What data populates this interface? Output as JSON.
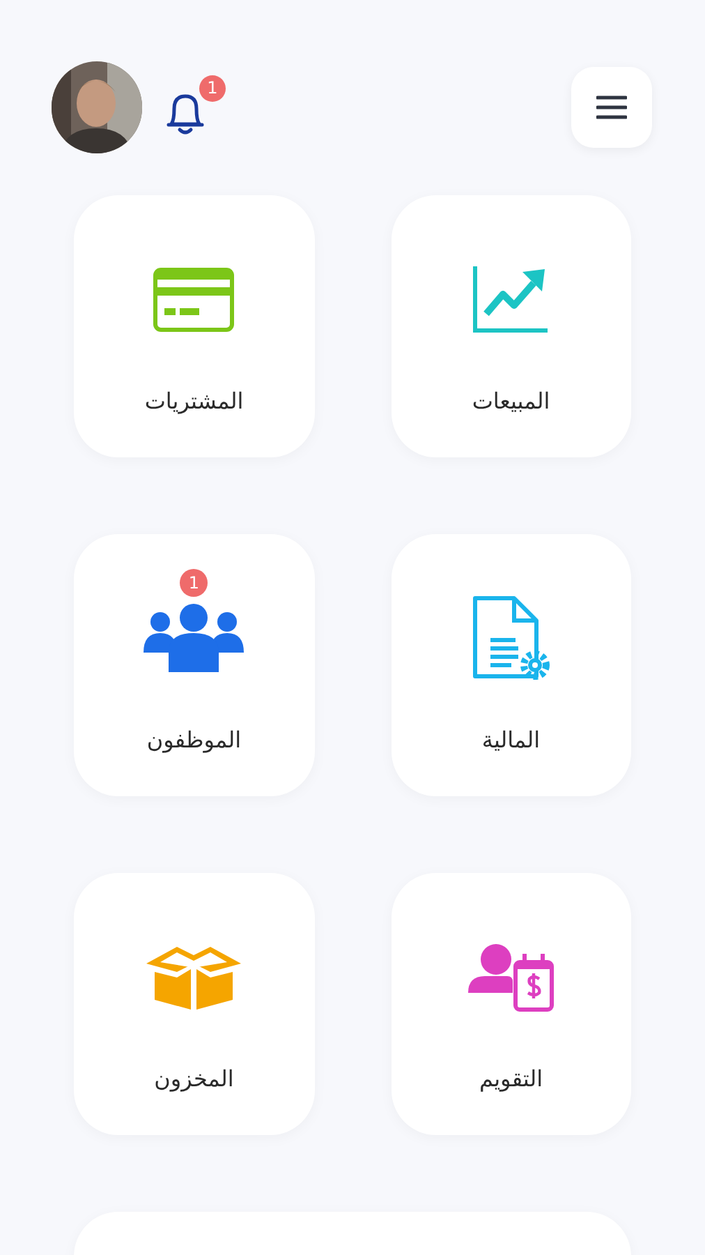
{
  "header": {
    "notifications_badge": "1"
  },
  "tile_rows": [
    {
      "tiles": [
        {
          "label": "المبيعات",
          "kind": "chart",
          "color": "#1cc4c4"
        },
        {
          "label": "المشتريات",
          "kind": "card",
          "color": "#7cc618"
        }
      ]
    },
    {
      "tiles": [
        {
          "label": "المالية",
          "kind": "document",
          "color": "#1ab4ec"
        },
        {
          "label": "الموظفون",
          "kind": "people",
          "color": "#1e6ee8",
          "badge": "1"
        }
      ]
    },
    {
      "tiles": [
        {
          "label": "التقويم",
          "kind": "calendar",
          "color": "#dd3fc0"
        },
        {
          "label": "المخزون",
          "kind": "box",
          "color": "#f5a500"
        }
      ]
    }
  ]
}
